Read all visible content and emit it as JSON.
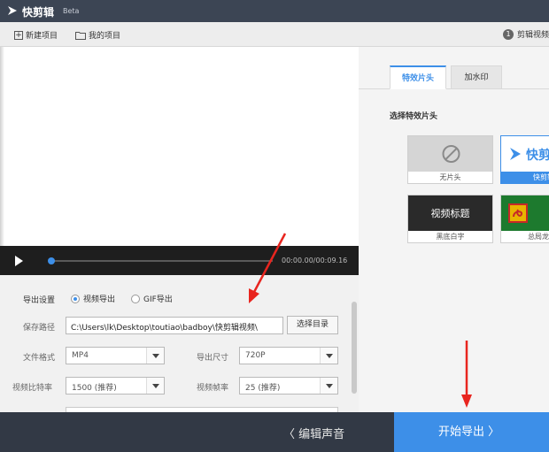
{
  "titlebar": {
    "app_name": "快剪辑",
    "beta": "Beta"
  },
  "toolbar": {
    "new_project": "新建项目",
    "my_videos": "我的项目",
    "step_number": "1",
    "step_label": "剪辑视频"
  },
  "player": {
    "timecode": "00:00.00/00:09.16"
  },
  "export": {
    "section_label": "导出设置",
    "radio_video": "视频导出",
    "radio_gif": "GIF导出",
    "selected": "视频导出",
    "path_label": "保存路径",
    "path_value": "C:\\Users\\lk\\Desktop\\toutiao\\badboy\\快剪辑视频\\",
    "browse_button": "选择目录",
    "format_label": "文件格式",
    "format_value": "MP4",
    "size_label": "导出尺寸",
    "size_value": "720P",
    "bitrate_label": "视频比特率",
    "bitrate_value": "1500 (推荐)",
    "fps_label": "视频帧率",
    "fps_value": "25 (推荐)"
  },
  "effects": {
    "tabs": [
      {
        "label": "特效片头",
        "active": true
      },
      {
        "label": "加水印",
        "active": false
      }
    ],
    "section_title": "选择特效片头",
    "openers": [
      {
        "caption": "无片头",
        "selected": false
      },
      {
        "caption": "快剪辑",
        "selected": true,
        "thumb_text": "快剪"
      },
      {
        "caption": "黑底白字",
        "selected": false,
        "thumb_text": "视频标题"
      },
      {
        "caption": "总局龙标",
        "selected": false
      }
    ]
  },
  "footer": {
    "edit_audio": "〈 编辑声音",
    "start_export": "开始导出 〉"
  },
  "colors": {
    "accent": "#3d8fe8",
    "titlebar": "#3c4554",
    "bottombar": "#323945",
    "annotation_arrow": "#e8251f"
  }
}
